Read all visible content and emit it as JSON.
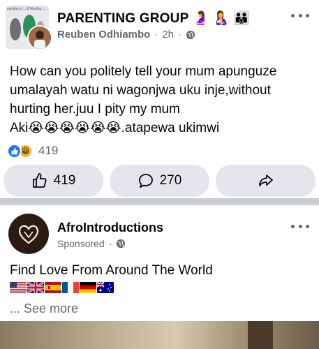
{
  "post": {
    "group_title": "PARENTING GROUP 🤰 🤱 👪",
    "group_thumb_text": "months in ... 8 Months ...",
    "author": "Reuben Odhiambo",
    "separator": "·",
    "time": "2h",
    "privacy_icon": "globe-icon",
    "text_lines": [
      "How can you politely tell your mum apunguze",
      "umalayah watu ni wagonjwa uku inje,without",
      "hurting her.juu I pity my mum",
      "Aki😭😭😭😭😭😭.atapewa ukimwi"
    ],
    "reactions": {
      "icons": [
        "like-reaction-icon",
        "haha-reaction-icon"
      ],
      "count": "419"
    },
    "actions": {
      "like_count": "419",
      "comment_count": "270"
    },
    "colors": {
      "like_blue": "#1877f2",
      "button_bg": "#e4e6eb",
      "meta_gray": "#65676b",
      "divider": "#cacdd1"
    }
  },
  "ad": {
    "brand_name": "AfroIntroductions",
    "sponsored_label": "Sponsored",
    "separator": "·",
    "privacy_icon": "globe-icon",
    "text": "Find Love From Around The World",
    "flags": [
      "us-flag",
      "uk-flag",
      "spain-flag",
      "france-flag",
      "germany-flag",
      "australia-flag"
    ],
    "see_more": "... See more"
  }
}
